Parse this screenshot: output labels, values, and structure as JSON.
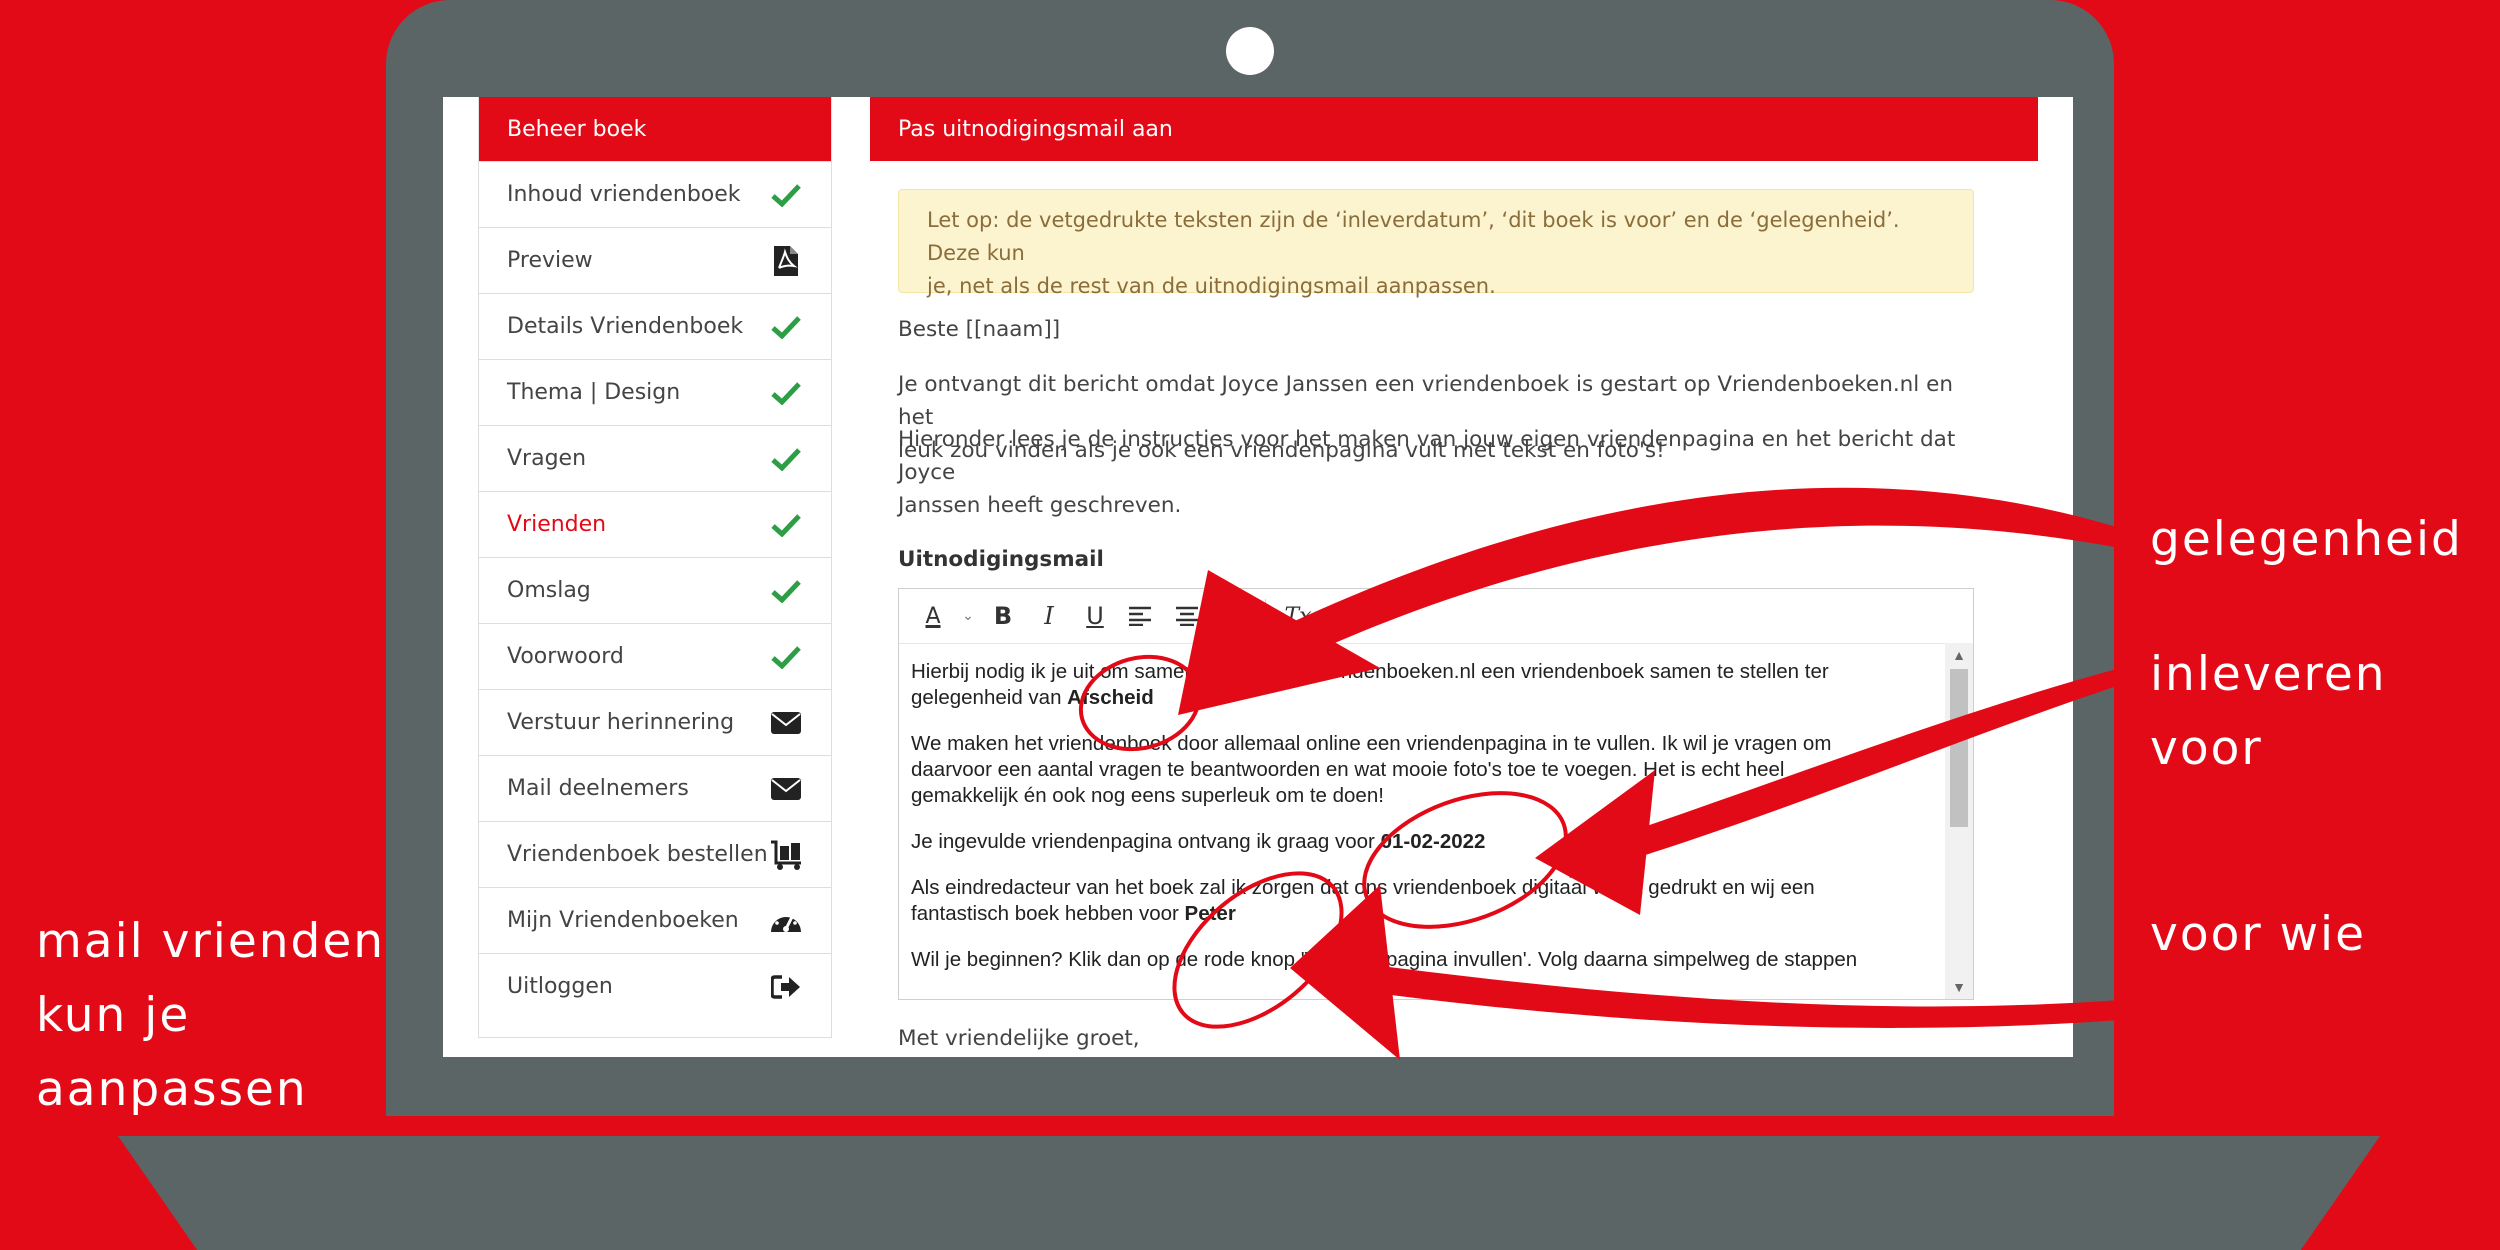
{
  "colors": {
    "brand_red": "#e30a17",
    "frame_gray": "#5b6566",
    "check_green": "#2e9e46",
    "alert_bg": "#fcf3cf",
    "alert_text": "#8a6d3b"
  },
  "sidebar": {
    "title": "Beheer boek",
    "items": [
      {
        "label": "Inhoud vriendenboek",
        "icon": "check-icon"
      },
      {
        "label": "Preview",
        "icon": "pdf-icon"
      },
      {
        "label": "Details Vriendenboek",
        "icon": "check-icon"
      },
      {
        "label": "Thema | Design",
        "icon": "check-icon"
      },
      {
        "label": "Vragen",
        "icon": "check-icon"
      },
      {
        "label": "Vrienden",
        "icon": "check-icon",
        "active": true
      },
      {
        "label": "Omslag",
        "icon": "check-icon"
      },
      {
        "label": "Voorwoord",
        "icon": "check-icon"
      },
      {
        "label": "Verstuur herinnering",
        "icon": "envelope-icon"
      },
      {
        "label": "Mail deelnemers",
        "icon": "envelope-icon"
      },
      {
        "label": "Vriendenboek bestellen",
        "icon": "luggage-cart-icon"
      },
      {
        "label": "Mijn Vriendenboeken",
        "icon": "dashboard-icon"
      },
      {
        "label": "Uitloggen",
        "icon": "sign-out-icon"
      }
    ]
  },
  "main": {
    "title": "Pas uitnodigingsmail aan",
    "alert_line1": "Let op: de vetgedrukte teksten zijn de ‘inleverdatum’, ‘dit boek is voor’ en de ‘gelegenheid’. Deze kun",
    "alert_line2": "je, net als de rest van de uitnodigingsmail aanpassen.",
    "greeting": "Beste [[naam]]",
    "intro_line1": "Je ontvangt dit bericht omdat Joyce Janssen een vriendenboek is gestart op Vriendenboeken.nl en het",
    "intro_line2": "leuk zou vinden als je ook een vriendenpagina vult met tekst en foto's!",
    "instr_line1": "Hieronder lees je de instructies voor het maken van jouw eigen vriendenpagina en het bericht dat Joyce",
    "instr_line2": "Janssen heeft geschreven.",
    "editor_heading": "Uitnodigingsmail",
    "closing": "Met vriendelijke groet,"
  },
  "editor": {
    "toolbar": [
      "A",
      "B",
      "I",
      "U",
      "≡",
      "≡",
      "≡",
      "Tx"
    ],
    "p1_line1": "Hierbij nodig ik je uit om samen met mij via Vriendenboeken.nl een vriendenboek samen te stellen ter",
    "p1_line2_prefix": "gelegenheid van ",
    "p1_occasion": "Afscheid",
    "p2_line1": "We maken het vriendenboek door allemaal online een vriendenpagina in te vullen. Ik wil je vragen om",
    "p2_line2": "daarvoor een aantal vragen te beantwoorden en wat mooie foto's toe te voegen. Het is echt heel",
    "p2_line3": "gemakkelijk én ook nog eens superleuk om te doen!",
    "p3_prefix": "Je ingevulde vriendenpagina ontvang ik graag voor ",
    "p3_date": "01-02-2022",
    "p4_line1": "Als eindredacteur van het boek zal ik zorgen dat ons vriendenboek digitaal wordt gedrukt en wij een",
    "p4_line2_prefix": "fantastisch boek hebben voor ",
    "p4_name": "Peter",
    "p5_line1": "Wil je beginnen? Klik dan op de rode knop 'Vriendenpagina invullen'. Volg daarna simpelweg de stappen"
  },
  "annotations": {
    "gelegenheid": "gelegenheid",
    "inleveren": "inleveren voor",
    "voor_wie": "voor wie",
    "mail_line1": "mail vrienden",
    "mail_line2": "kun je",
    "mail_line3": "aanpassen"
  }
}
